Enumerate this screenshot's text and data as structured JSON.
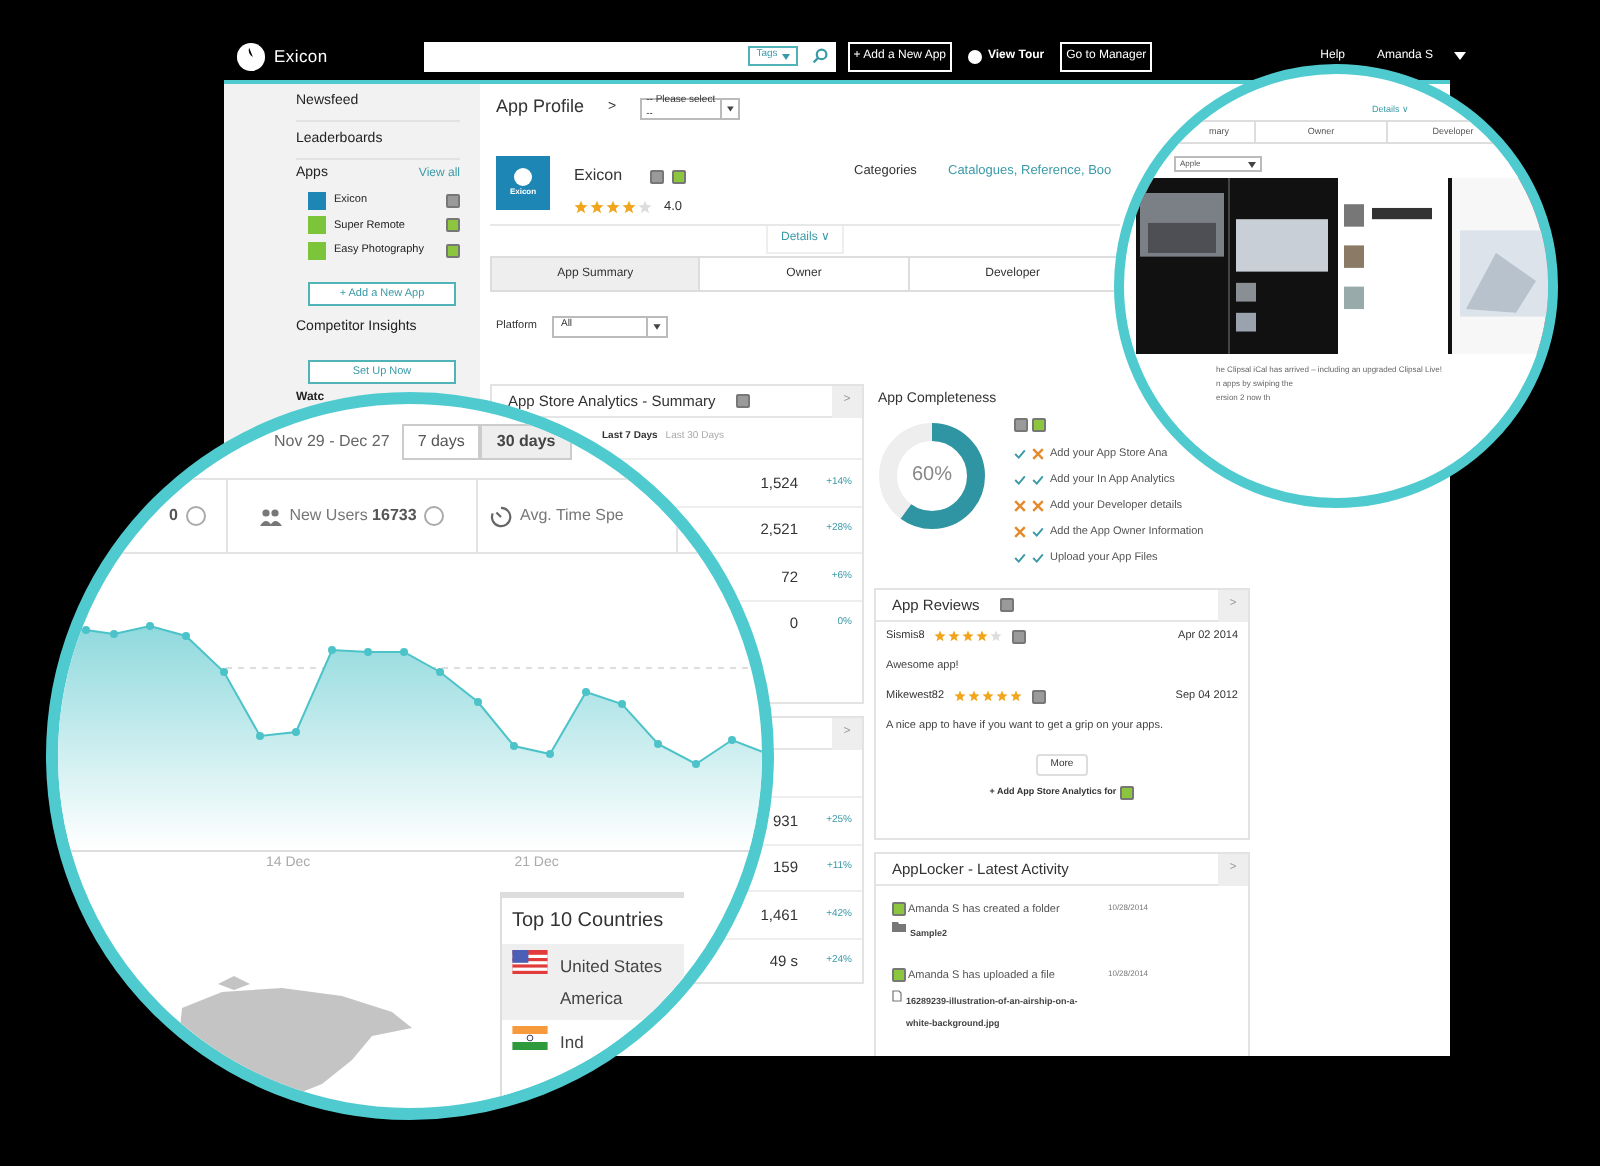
{
  "top_bar": {
    "logo": "Exicon",
    "tags": "Tags",
    "buttons": [
      "+ Add a New App",
      "View Tour",
      "Go to Manager"
    ],
    "help": "Help",
    "user": "Amanda S"
  },
  "sidebar": {
    "items": [
      "Newsfeed",
      "Leaderboards"
    ],
    "apps_heading": "Apps",
    "view_all": "View all",
    "apps": [
      {
        "name": "Exicon",
        "kind": "ios"
      },
      {
        "name": "Super Remote",
        "kind": "android"
      },
      {
        "name": "Easy Photography",
        "kind": "android"
      }
    ],
    "add_app": "+ Add a New App",
    "competitor_heading": "Competitor Insights",
    "set_up": "Set Up Now",
    "watchlist": "Watc"
  },
  "header": {
    "title": "App Profile",
    "separator": ">",
    "select": "-- Please select --"
  },
  "app": {
    "name": "Exicon",
    "logo": "Exicon",
    "stars": 4,
    "rating": "4.0",
    "categories_label": "Categories",
    "categories": "Catalogues, Reference, Boo",
    "details": "Details ∨"
  },
  "tabs": [
    {
      "label": "App Summary",
      "selected": true
    },
    {
      "label": "Owner",
      "selected": false
    },
    {
      "label": "Developer",
      "selected": false
    }
  ],
  "platform": {
    "label": "Platform",
    "value": "All"
  },
  "analytics": {
    "title": "App Store Analytics - Summary",
    "more": ">",
    "ranges": [
      {
        "label": "Last 7 Days",
        "selected": true
      },
      {
        "label": "Last 30 Days",
        "selected": false
      }
    ],
    "rows": [
      {
        "value": "1,524",
        "change": "+14%"
      },
      {
        "value": "2,521",
        "change": "+28%"
      },
      {
        "value": "72",
        "change": "+6%"
      },
      {
        "value": "0",
        "change": "0%"
      }
    ]
  },
  "analytics_2": {
    "more": ">",
    "rows": [
      {
        "value": "931",
        "change": "+25%"
      },
      {
        "value": "159",
        "change": "+11%"
      },
      {
        "value": "1,461",
        "change": "+42%"
      },
      {
        "value": "49 s",
        "change": "+24%"
      }
    ]
  },
  "completeness": {
    "title": "App Completeness",
    "percent": "60%",
    "level": 0.6,
    "items": [
      {
        "text": "Add your App Store Ana",
        "ios_done": true,
        "android_done": false
      },
      {
        "text": "Add your In App Analytics",
        "ios_done": true,
        "android_done": true
      },
      {
        "text": "Add your Developer details",
        "ios_done": false,
        "android_done": false
      },
      {
        "text": "Add the App Owner Information",
        "ios_done": false,
        "android_done": true
      },
      {
        "text": "Upload your App Files",
        "ios_done": true,
        "android_done": true
      }
    ]
  },
  "reviews": {
    "title": "App Reviews",
    "more": ">",
    "items": [
      {
        "user": "Sismis8",
        "stars": 4,
        "date": "Apr 02 2014",
        "text": "Awesome app!"
      },
      {
        "user": "Mikewest82",
        "stars": 5,
        "date": "Sep 04 2012",
        "text": "A nice app to have if you want to get a grip on your apps."
      }
    ],
    "more_button": "More",
    "add_analytics": "+ Add App Store Analytics for"
  },
  "activity": {
    "title": "AppLocker - Latest Activity",
    "more": ">",
    "items": [
      {
        "text": "Amanda S has created a folder",
        "date": "10/28/2014",
        "kind": "folder",
        "lines": [
          "Sample2"
        ]
      },
      {
        "text": "Amanda S has uploaded a file",
        "date": "10/28/2014",
        "kind": "file",
        "lines": [
          "16289239-illustration-of-an-airship-on-a-",
          "white-background.jpg"
        ]
      }
    ]
  },
  "zoom_left": {
    "date_range": "Nov 29 - Dec 27",
    "ranges": [
      {
        "label": "7 days",
        "selected": false
      },
      {
        "label": "30 days",
        "selected": true
      }
    ],
    "stats": [
      {
        "kind": "plain",
        "value": "0"
      },
      {
        "kind": "users",
        "label": "New Users",
        "value": "16733"
      },
      {
        "kind": "time",
        "label": "Avg. Time Spe"
      }
    ],
    "xticks": [
      "14 Dec",
      "21 Dec"
    ],
    "countries": {
      "title": "Top 10 Countries",
      "items": [
        {
          "lines": [
            "United States",
            "America"
          ],
          "kind": "us",
          "selected": true
        },
        {
          "lines": [
            "Ind"
          ],
          "kind": "in",
          "selected": false
        }
      ]
    }
  },
  "zoom_right": {
    "details": "Details ∨",
    "tabs": [
      "mary",
      "Owner",
      "Developer"
    ],
    "select": "Apple",
    "description": [
      "he Clipsal iCal has arrived – including an upgraded Clipsal Live!",
      "n apps by swiping the",
      "ersion 2 now th"
    ]
  }
}
